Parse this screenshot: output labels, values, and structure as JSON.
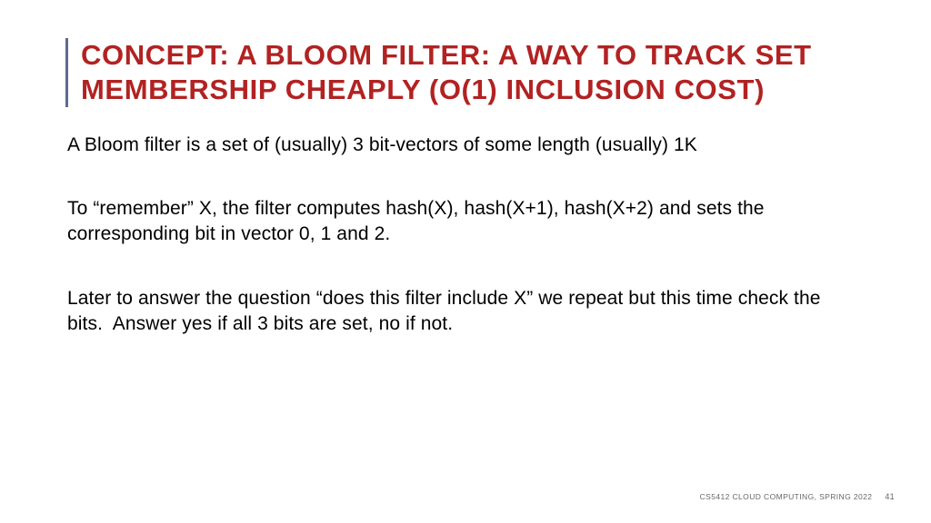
{
  "slide": {
    "title": "CONCEPT: A BLOOM FILTER: A WAY TO TRACK SET MEMBERSHIP CHEAPLY (O(1) INCLUSION COST)",
    "paragraphs": [
      "A Bloom filter is a set of (usually) 3 bit-vectors of some length (usually) 1K",
      "To “remember” X, the filter computes hash(X), hash(X+1), hash(X+2) and sets the corresponding bit in vector 0, 1 and 2.",
      "Later to answer the question “does this filter include X” we repeat but this time check the bits.  Answer yes if all 3 bits are set, no if not."
    ],
    "footer_course": "CS5412 CLOUD COMPUTING, SPRING 2022",
    "footer_page": "41"
  }
}
